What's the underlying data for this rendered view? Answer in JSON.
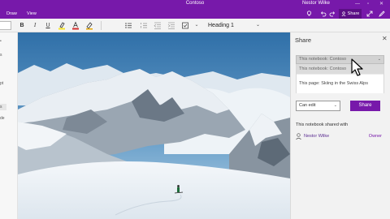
{
  "window": {
    "title": "Contoso",
    "user": "Nestor Wilke",
    "controls": [
      "—",
      "▫",
      "✕"
    ]
  },
  "menubar": {
    "items": [
      "Draw",
      "View"
    ],
    "share_label": "Share",
    "icons": [
      "lightbulb-icon",
      "undo-icon",
      "redo-icon",
      "pen-icon",
      "expand-icon",
      "more-icon"
    ]
  },
  "toolbar": {
    "bold": "B",
    "italic": "I",
    "underline": "U",
    "style_value": "Heading 1",
    "style_chevron": "⌄"
  },
  "sidebar": {
    "items": [
      "•",
      "s",
      "pt",
      "s",
      "de"
    ]
  },
  "share_panel": {
    "title": "Share",
    "dropdown_selected": "This notebook: Contoso",
    "options": [
      "This notebook: Contoso",
      "This page: Skiing in the Swiss Alps"
    ],
    "permission": "Can edit",
    "share_button": "Share",
    "shared_with_label": "This notebook shared with",
    "people": [
      {
        "name": "Nestor Wilke",
        "role": "Owner"
      }
    ]
  }
}
